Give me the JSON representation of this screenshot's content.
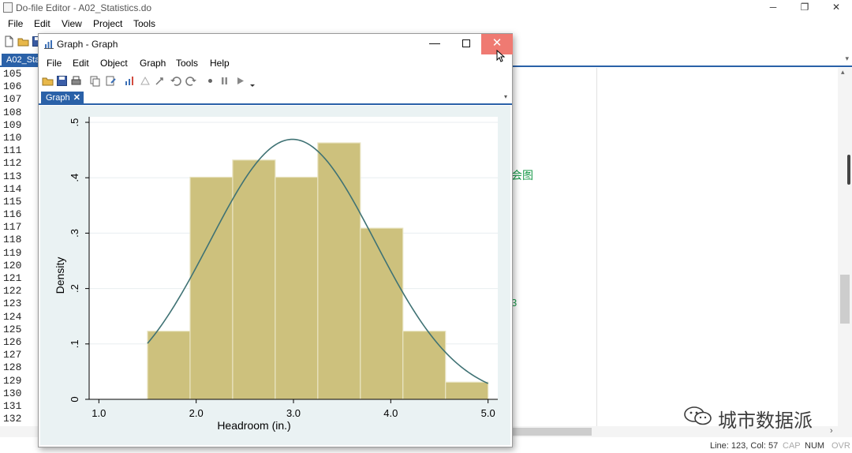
{
  "editor": {
    "title": "Do-file Editor - A02_Statistics.do",
    "window_controls": {
      "minimize": "─",
      "restore": "❐",
      "close": "✕"
    },
    "menu": [
      "File",
      "Edit",
      "View",
      "Project",
      "Tools"
    ],
    "tab_label": "A02_Statistics.do",
    "line_numbers": [
      "105",
      "106",
      "107",
      "108",
      "109",
      "110",
      "111",
      "112",
      "113",
      "114",
      "115",
      "116",
      "117",
      "118",
      "119",
      "120",
      "121",
      "122",
      "123",
      "124",
      "125",
      "126",
      "127",
      "128",
      "129",
      "130",
      "131",
      "132"
    ],
    "visible_code_fragment": "会图",
    "visible_code_fragment2": "3",
    "status": {
      "position": "Line: 123, Col: 57",
      "cap": "CAP",
      "num": "NUM",
      "ovr": "OVR"
    }
  },
  "watermark": {
    "text": "城市数据派"
  },
  "graph_window": {
    "title": "Graph - Graph",
    "window_controls": {
      "minimize": "—",
      "close": "✕"
    },
    "menu": [
      "File",
      "Edit",
      "Object",
      "Graph",
      "Tools",
      "Help"
    ],
    "tab_label": "Graph",
    "tab_close": "✕",
    "tab_dropdown": "▾"
  },
  "colors": {
    "accent": "#2a61a8",
    "close_hover": "#ef7a72",
    "bar_fill": "#cdc17d",
    "bar_edge": "#e9e4c2",
    "curve": "#3f7274",
    "graph_region": "#eaf2f3",
    "code_green": "#1a9a4a"
  },
  "chart_data": {
    "type": "bar",
    "xlabel": "Headroom (in.)",
    "ylabel": "Density",
    "xlim": [
      0.9,
      5.1
    ],
    "ylim": [
      0,
      0.51
    ],
    "xticks": [
      1.0,
      2.0,
      3.0,
      4.0,
      5.0
    ],
    "xtick_labels": [
      "1.0",
      "2.0",
      "3.0",
      "4.0",
      "5.0"
    ],
    "yticks": [
      0,
      0.1,
      0.2,
      0.3,
      0.4,
      0.5
    ],
    "ytick_labels": [
      "0",
      ".1",
      ".2",
      ".3",
      ".4",
      ".5"
    ],
    "grid": true,
    "bins": [
      {
        "x0": 1.5,
        "x1": 1.9375,
        "density": 0.123
      },
      {
        "x0": 1.9375,
        "x1": 2.375,
        "density": 0.401
      },
      {
        "x0": 2.375,
        "x1": 2.8125,
        "density": 0.432
      },
      {
        "x0": 2.8125,
        "x1": 3.25,
        "density": 0.401
      },
      {
        "x0": 3.25,
        "x1": 3.6875,
        "density": 0.463
      },
      {
        "x0": 3.6875,
        "x1": 4.125,
        "density": 0.309
      },
      {
        "x0": 4.125,
        "x1": 4.5625,
        "density": 0.123
      },
      {
        "x0": 4.5625,
        "x1": 5.0,
        "density": 0.031
      }
    ],
    "normal_curve": {
      "mean": 2.99,
      "sd": 0.85,
      "x_range": [
        1.5,
        5.0
      ]
    }
  }
}
